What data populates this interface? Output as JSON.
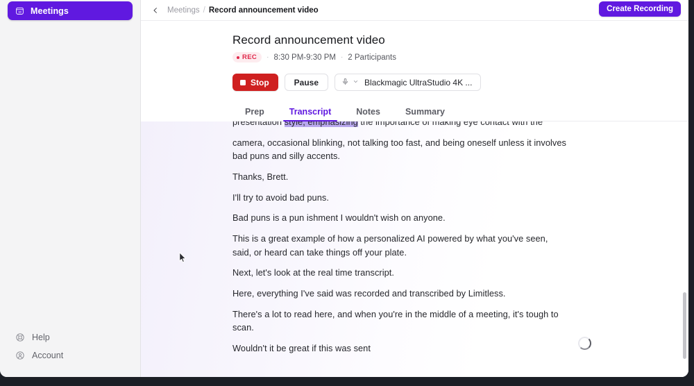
{
  "sidebar": {
    "nav": [
      {
        "label": "Meetings",
        "icon": "calendar-icon",
        "active": true
      }
    ],
    "bottom": [
      {
        "label": "Help",
        "icon": "lifebuoy-icon"
      },
      {
        "label": "Account",
        "icon": "user-circle-icon"
      }
    ]
  },
  "topbar": {
    "back_icon": "chevron-left-icon",
    "breadcrumb_parent": "Meetings",
    "breadcrumb_separator": "/",
    "breadcrumb_current": "Record announcement video",
    "create_recording_label": "Create Recording"
  },
  "meeting": {
    "title": "Record announcement video",
    "rec_badge": "REC",
    "time_range": "8:30 PM-9:30 PM",
    "separator": "·",
    "participants": "2 Participants",
    "controls": {
      "stop_label": "Stop",
      "pause_label": "Pause",
      "mic_icon": "microphone-icon",
      "chevron_icon": "chevron-down-icon",
      "device_label": "Blackmagic UltraStudio 4K ..."
    },
    "tabs": [
      {
        "label": "Prep",
        "active": false
      },
      {
        "label": "Transcript",
        "active": true
      },
      {
        "label": "Notes",
        "active": false
      },
      {
        "label": "Summary",
        "active": false
      }
    ]
  },
  "transcript": {
    "clipped_line_before": "presentation ",
    "clipped_line_selected": "style, emphasizing",
    "clipped_line_after": " the importance of making eye contact with the",
    "paragraphs": [
      "camera, occasional blinking, not talking too fast, and being oneself unless it involves bad puns and silly accents.",
      "Thanks, Brett.",
      "I'll try to avoid bad puns.",
      "Bad puns is a pun ishment I wouldn't wish on anyone.",
      "This is a great example of how a personalized AI powered by what you've seen, said, or heard can take things off your plate.",
      "Next, let's look at the real time transcript.",
      "Here, everything I've said was recorded and transcribed by Limitless.",
      "There's a lot to read here, and when you're in the middle of a meeting, it's tough to scan.",
      "Wouldn't it be great if this was sent"
    ],
    "loading_icon": "spinner-icon"
  },
  "colors": {
    "accent_purple": "#6019e0",
    "stop_red": "#cf2020",
    "rec_red": "#e0284a",
    "sidebar_bg": "#f4f4f5",
    "selection": "#b9a8ee"
  }
}
